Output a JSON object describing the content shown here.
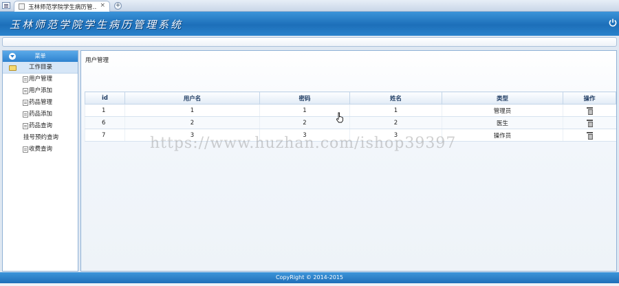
{
  "browser": {
    "tab_title": "玉林师范学院学生病历管...",
    "close_glyph": "×",
    "new_tab_glyph": "+"
  },
  "app": {
    "title": "玉林师范学院学生病历管理系统"
  },
  "sidebar": {
    "menu_label": "菜单",
    "folder_label": "工作目录",
    "items": [
      {
        "label": "用户管理",
        "icon": "doc-icon"
      },
      {
        "label": "用户添加",
        "icon": "doc-icon"
      },
      {
        "label": "药品管理",
        "icon": "doc-icon"
      },
      {
        "label": "药品添加",
        "icon": "doc-icon"
      },
      {
        "label": "药品查询",
        "icon": "doc-icon"
      },
      {
        "label": "挂号预约查询",
        "icon": ""
      },
      {
        "label": "收费查询",
        "icon": "doc-icon"
      }
    ]
  },
  "main": {
    "breadcrumb": "用户管理",
    "table": {
      "columns": [
        "id",
        "用户名",
        "密码",
        "姓名",
        "类型",
        "操作"
      ],
      "rows": [
        {
          "id": "1",
          "username": "1",
          "password": "1",
          "name": "1",
          "type": "管理员"
        },
        {
          "id": "6",
          "username": "2",
          "password": "2",
          "name": "2",
          "type": "医生"
        },
        {
          "id": "7",
          "username": "3",
          "password": "3",
          "name": "3",
          "type": "操作员"
        }
      ]
    }
  },
  "watermark": "https://www.huzhan.com/ishop39397",
  "footer": {
    "copyright": "CopyRight © 2014-2015"
  },
  "colors": {
    "header_blue": "#1d6fb9",
    "sidebar_border": "#8fb1d6"
  }
}
